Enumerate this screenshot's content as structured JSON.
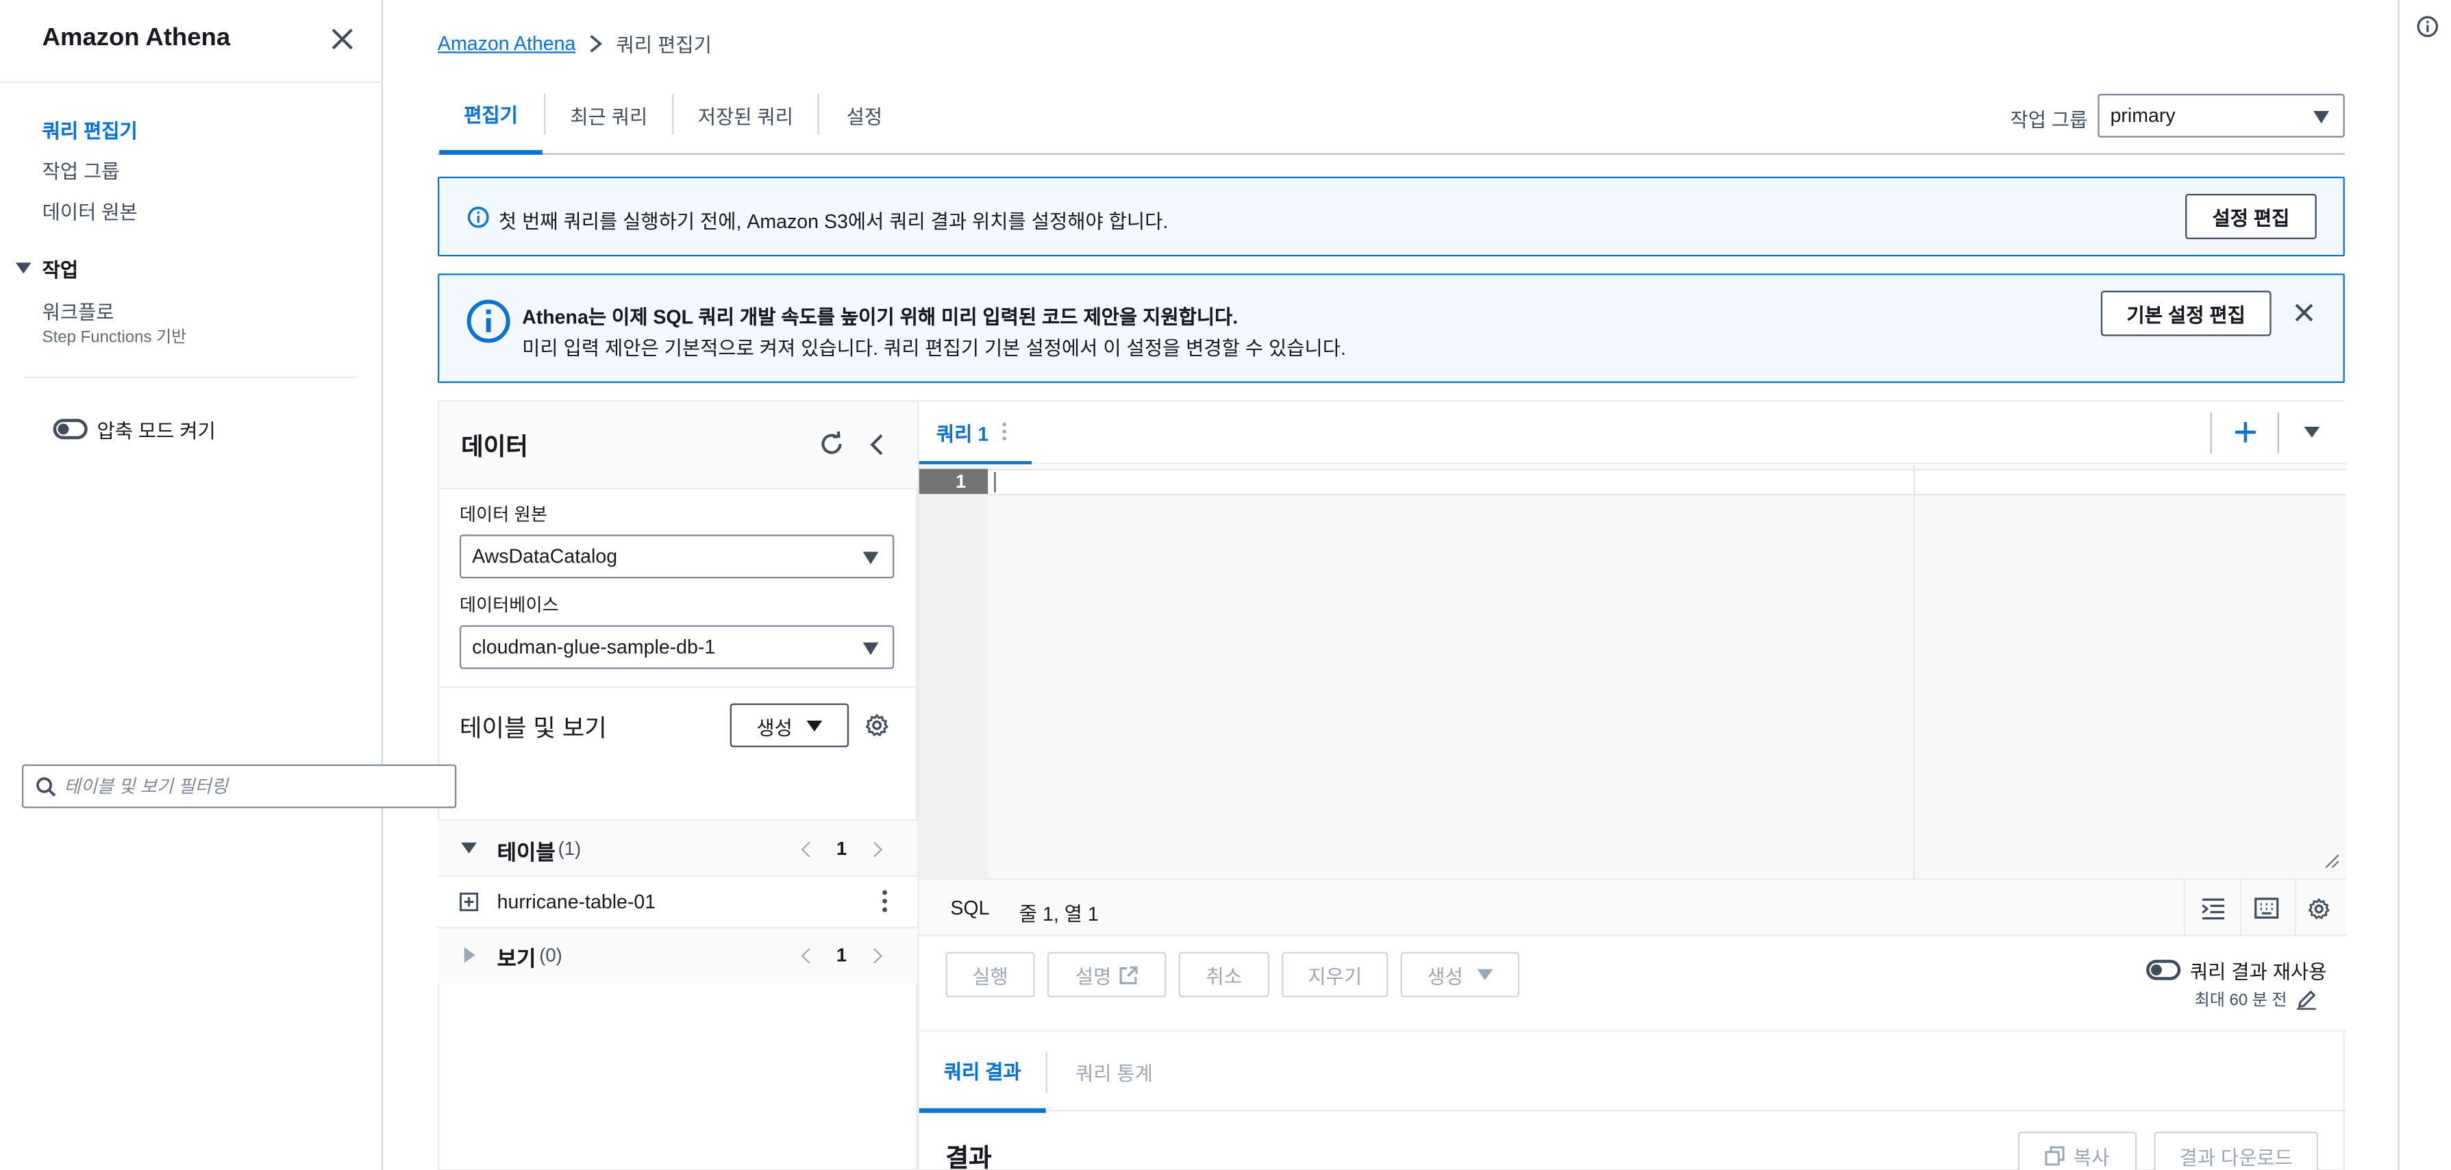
{
  "nav": {
    "title": "Amazon Athena",
    "links": [
      "쿼리 편집기",
      "작업 그룹",
      "데이터 원본"
    ],
    "section": "작업",
    "workflow": "워크플로",
    "workflow_sub": "Step Functions 기반",
    "compact_mode": "압축 모드 켜기"
  },
  "breadcrumb": {
    "root": "Amazon Athena",
    "current": "쿼리 편집기"
  },
  "tabs": [
    "편집기",
    "최근 쿼리",
    "저장된 쿼리",
    "설정"
  ],
  "workgroup": {
    "label": "작업 그룹",
    "value": "primary"
  },
  "banner1": {
    "text": "첫 번째 쿼리를 실행하기 전에, Amazon S3에서 쿼리 결과 위치를 설정해야 합니다.",
    "button": "설정 편집"
  },
  "banner2": {
    "title": "Athena는 이제 SQL 쿼리 개발 속도를 높이기 위해 미리 입력된 코드 제안을 지원합니다.",
    "body": "미리 입력 제안은 기본적으로 켜져 있습니다. 쿼리 편집기 기본 설정에서 이 설정을 변경할 수 있습니다.",
    "button": "기본 설정 편집"
  },
  "data_panel": {
    "title": "데이터",
    "source_label": "데이터 원본",
    "source_value": "AwsDataCatalog",
    "db_label": "데이터베이스",
    "db_value": "cloudman-glue-sample-db-1",
    "tv_title": "테이블 및 보기",
    "create_button": "생성",
    "search_placeholder": "테이블 및 보기 필터링",
    "tables_label": "테이블",
    "tables_count": "(1)",
    "tables_page": "1",
    "table_item": "hurricane-table-01",
    "views_label": "보기",
    "views_count": "(0)",
    "views_page": "1"
  },
  "editor": {
    "tab_label": "쿼리 1",
    "line_number": "1",
    "lang": "SQL",
    "position": "줄 1, 열 1",
    "buttons": {
      "run": "실행",
      "explain": "설명",
      "cancel": "취소",
      "clear": "지우기",
      "create": "생성"
    },
    "reuse_label": "쿼리 결과 재사용",
    "reuse_sub": "최대 60 분 전",
    "result_tabs": [
      "쿼리 결과",
      "쿼리 통계"
    ],
    "results_title": "결과",
    "copy_button": "복사",
    "download_button": "결과 다운로드"
  },
  "colors": {
    "accent": "#0972d3",
    "text": "#16191f",
    "info_bg": "#f2f8fd"
  },
  "icons": [
    "close-icon",
    "caret-down-icon",
    "toggle-icon",
    "info-icon",
    "refresh-icon",
    "chevron-left-icon",
    "gear-icon",
    "search-icon",
    "expand-square-icon",
    "kebab-icon",
    "plus-icon",
    "indent-icon",
    "keyboard-icon",
    "external-link-icon",
    "pencil-icon",
    "copy-icon"
  ]
}
